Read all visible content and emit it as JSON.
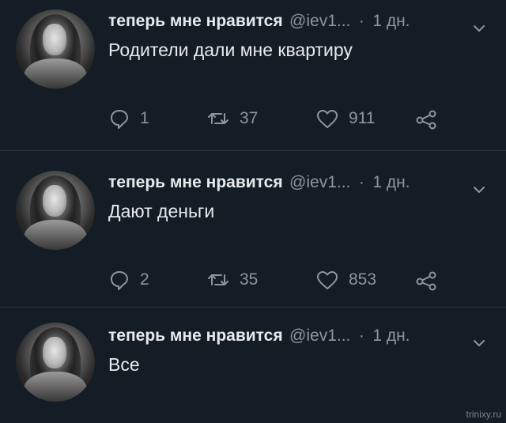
{
  "tweets": [
    {
      "display_name": "теперь мне нравится",
      "handle": "@iev1...",
      "separator": "·",
      "time": "1 дн.",
      "text": "Родители дали мне квартиру",
      "replies": "1",
      "retweets": "37",
      "likes": "911"
    },
    {
      "display_name": "теперь мне нравится",
      "handle": "@iev1...",
      "separator": "·",
      "time": "1 дн.",
      "text": "Дают деньги",
      "replies": "2",
      "retweets": "35",
      "likes": "853"
    },
    {
      "display_name": "теперь мне нравится",
      "handle": "@iev1...",
      "separator": "·",
      "time": "1 дн.",
      "text": "Все"
    }
  ],
  "watermark": "trinixy.ru",
  "colors": {
    "background": "#141d26",
    "primary_text": "#e7eaed",
    "secondary_text": "#8a96a3",
    "divider": "#2a3642"
  },
  "icons": [
    "reply-icon",
    "retweet-icon",
    "like-icon",
    "share-icon",
    "chevron-down-icon"
  ]
}
